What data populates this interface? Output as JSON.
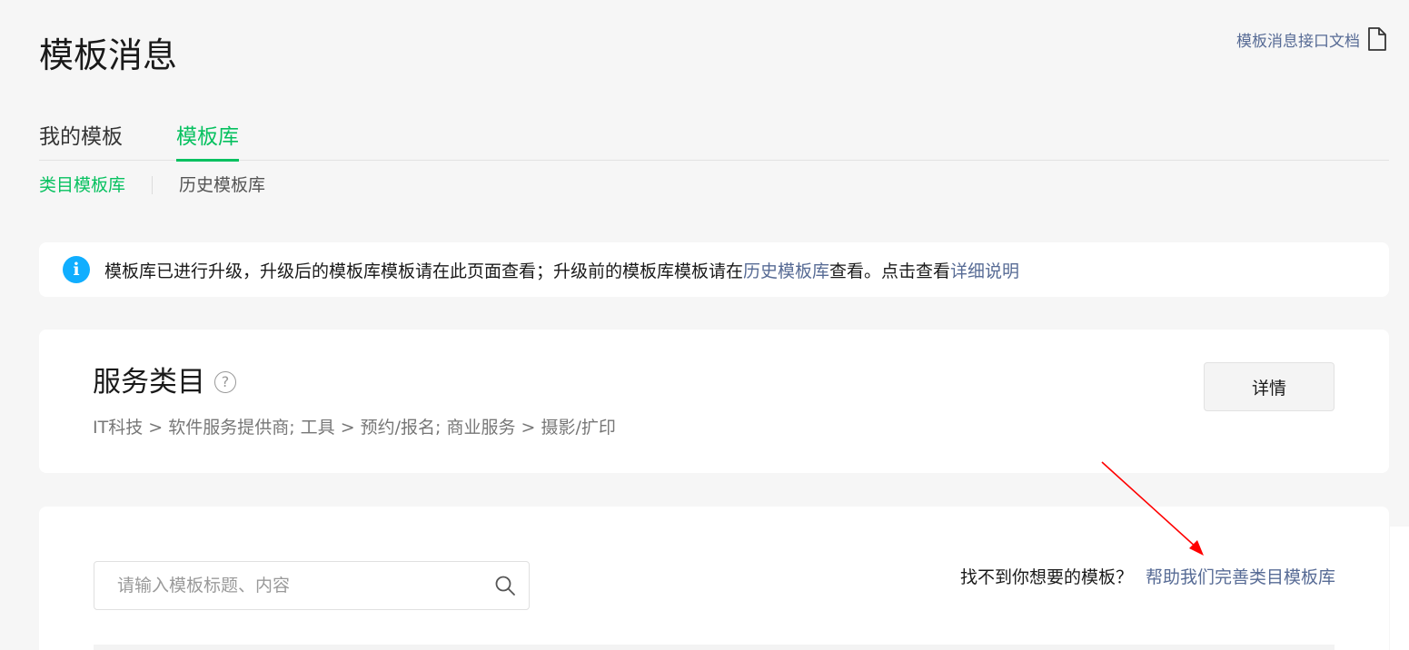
{
  "header": {
    "title": "模板消息",
    "doc_link": "模板消息接口文档"
  },
  "tabs": [
    {
      "label": "我的模板",
      "active": false
    },
    {
      "label": "模板库",
      "active": true
    }
  ],
  "subtabs": [
    {
      "label": "类目模板库",
      "active": true
    },
    {
      "label": "历史模板库",
      "active": false
    }
  ],
  "notice": {
    "text_before": "模板库已进行升级，升级后的模板库模板请在此页面查看；升级前的模板库模板请在",
    "link_history": "历史模板库",
    "text_middle": "查看。点击查看",
    "link_detail": "详细说明"
  },
  "category": {
    "title": "服务类目",
    "path": "IT科技 > 软件服务提供商; 工具 > 预约/报名; 商业服务 > 摄影/扩印",
    "detail_button": "详情"
  },
  "library": {
    "search_placeholder": "请输入模板标题、内容",
    "search_value": "",
    "feedback_text": "找不到你想要的模板？",
    "feedback_link": "帮助我们完善类目模板库"
  },
  "colors": {
    "accent": "#07c160",
    "link": "#576b95",
    "info": "#10aeff",
    "annotation": "#ff0000"
  },
  "icons": {
    "doc": "document-icon",
    "info": "info-icon",
    "help": "help-circle-icon",
    "search": "search-icon"
  }
}
